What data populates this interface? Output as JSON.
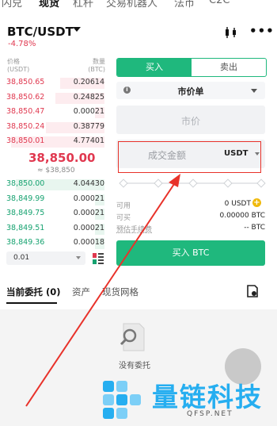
{
  "top_tabs": [
    "闪兑",
    "现货",
    "杠杆",
    "交易机器人",
    "法币",
    "C2C"
  ],
  "pair": {
    "symbol": "BTC/USDT",
    "change": "-4.78%"
  },
  "orderbook": {
    "price_header": "价格",
    "price_unit": "(USDT)",
    "qty_header": "数量",
    "qty_unit": "(BTC)",
    "asks": [
      {
        "price": "38,850.65",
        "qty": "0.20614",
        "depth": 0.45
      },
      {
        "price": "38,850.62",
        "qty": "0.24825",
        "depth": 0.5
      },
      {
        "price": "38,850.47",
        "qty": "0.00021",
        "depth": 0.1
      },
      {
        "price": "38,850.24",
        "qty": "0.38779",
        "depth": 0.6
      },
      {
        "price": "38,850.01",
        "qty": "4.77401",
        "depth": 0.95
      }
    ],
    "last_price": "38,850.00",
    "last_price_fiat": "≈ $38,850",
    "bids": [
      {
        "price": "38,850.00",
        "qty": "4.04430",
        "depth": 0.9
      },
      {
        "price": "38,849.99",
        "qty": "0.00021",
        "depth": 0.1
      },
      {
        "price": "38,849.75",
        "qty": "0.00021",
        "depth": 0.1
      },
      {
        "price": "38,849.51",
        "qty": "0.00021",
        "depth": 0.1
      },
      {
        "price": "38,849.36",
        "qty": "0.00018",
        "depth": 0.1
      }
    ],
    "precision": "0.01"
  },
  "form": {
    "buy_tab": "买入",
    "sell_tab": "卖出",
    "order_type": "市价单",
    "price_placeholder": "市价",
    "amount_placeholder": "成交金额",
    "amount_unit": "USDT",
    "available_label": "可用",
    "available_value": "0 USDT",
    "can_buy_label": "可买",
    "can_buy_value": "0.00000 BTC",
    "fee_label": "预估手续费",
    "fee_value": "-- BTC",
    "buy_button": "买入 BTC"
  },
  "bottom_tabs": [
    "当前委托 (0)",
    "资产",
    "现货网格"
  ],
  "empty_text": "没有委托",
  "watermark": {
    "name": "量链科技",
    "url": "QFSP.NET"
  },
  "colors": {
    "ask": "#e0384f",
    "bid": "#16a270",
    "buy": "#1fb87d",
    "highlight": "#e8322a",
    "watermark": "#26aef0"
  }
}
